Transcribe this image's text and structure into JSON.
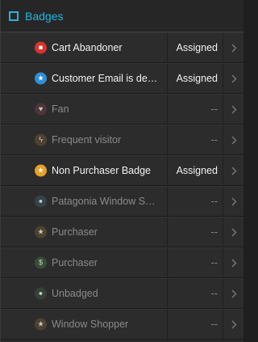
{
  "header": {
    "title": "Badges",
    "accent": "#1fb6e6"
  },
  "rows": [
    {
      "name": "Cart Abandoner",
      "status": "Assigned",
      "active": true,
      "icon": "cart-icon",
      "icon_bg": "#d9342b",
      "glyph": "■"
    },
    {
      "name": "Customer Email is de…",
      "status": "Assigned",
      "active": true,
      "icon": "trophy-icon",
      "icon_bg": "#2f8fd8",
      "glyph": "★"
    },
    {
      "name": "Fan",
      "status": "--",
      "active": false,
      "icon": "heart-icon",
      "icon_bg": "#5a3a3a",
      "glyph": "♥"
    },
    {
      "name": "Frequent visitor",
      "status": "--",
      "active": false,
      "icon": "lightning-icon",
      "icon_bg": "#5a4a30",
      "glyph": "ϟ"
    },
    {
      "name": "Non Purchaser Badge",
      "status": "Assigned",
      "active": true,
      "icon": "trophy-icon",
      "icon_bg": "#e5a226",
      "glyph": "★"
    },
    {
      "name": "Patagonia Window S…",
      "status": "--",
      "active": false,
      "icon": "user-icon",
      "icon_bg": "#3a4a55",
      "glyph": "●"
    },
    {
      "name": "Purchaser",
      "status": "--",
      "active": false,
      "icon": "trophy-icon",
      "icon_bg": "#5a4a30",
      "glyph": "★"
    },
    {
      "name": "Purchaser",
      "status": "--",
      "active": false,
      "icon": "dollar-icon",
      "icon_bg": "#3a5a3a",
      "glyph": "$"
    },
    {
      "name": "Unbadged",
      "status": "--",
      "active": false,
      "icon": "user-icon",
      "icon_bg": "#3a4a3a",
      "glyph": "●"
    },
    {
      "name": "Window Shopper",
      "status": "--",
      "active": false,
      "icon": "trophy-icon",
      "icon_bg": "#5a4a30",
      "glyph": "★"
    }
  ]
}
